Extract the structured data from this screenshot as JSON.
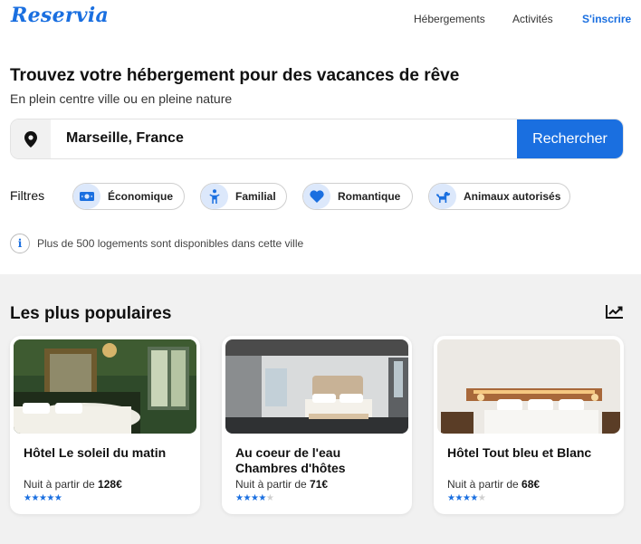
{
  "brand": {
    "logo": "Reservia",
    "accent": "#1a6fe0"
  },
  "nav": {
    "items": [
      "Hébergements",
      "Activités",
      "S'inscrire"
    ]
  },
  "hero": {
    "title": "Trouvez votre hébergement pour des vacances de rêve",
    "subtitle": "En plein centre ville ou en pleine nature"
  },
  "search": {
    "icon": "location-pin-icon",
    "value": "Marseille, France",
    "button": "Rechercher"
  },
  "filters": {
    "label": "Filtres",
    "items": [
      {
        "label": "Économique",
        "icon": "money-icon"
      },
      {
        "label": "Familial",
        "icon": "person-icon"
      },
      {
        "label": "Romantique",
        "icon": "heart-icon"
      },
      {
        "label": "Animaux autorisés",
        "icon": "dog-icon"
      }
    ]
  },
  "info": {
    "icon": "info-icon",
    "text": "Plus de 500 logements sont disponibles dans cette ville"
  },
  "popular": {
    "title": "Les plus populaires",
    "icon": "trending-up-icon",
    "cards": [
      {
        "name": "Hôtel Le soleil du matin",
        "price_prefix": "Nuit à partir de",
        "price": "128€",
        "rating": 5,
        "max_rating": 5
      },
      {
        "name": "Au coeur de l'eau Chambres d'hôtes",
        "price_prefix": "Nuit à partir de",
        "price": "71€",
        "rating": 4,
        "max_rating": 5
      },
      {
        "name": "Hôtel Tout bleu et Blanc",
        "price_prefix": "Nuit à partir de",
        "price": "68€",
        "rating": 4,
        "max_rating": 5
      }
    ]
  }
}
